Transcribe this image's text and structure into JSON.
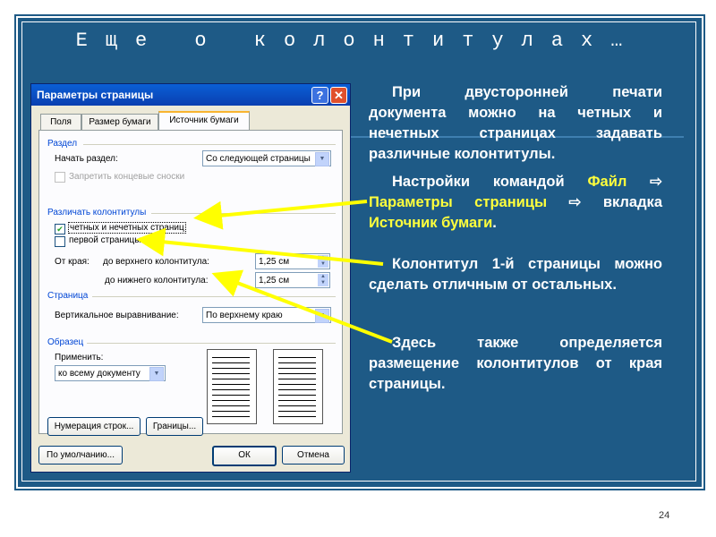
{
  "slide": {
    "title": "Еще о колонтитулах…",
    "page_number": "24",
    "paragraphs": [
      {
        "text": "При двусторонней печати документа можно на четных и нечетных страницах задавать различные колонтитулы."
      },
      {
        "pre": "Настройки командой ",
        "hl1": "Файл",
        "mid1": " ⇨ ",
        "hl2": "Параметры страницы",
        "mid2": " ⇨ вкладка ",
        "hl3": "Источник бумаги",
        "post": "."
      },
      {
        "text": "Колонтитул 1-й страницы можно сделать отличным от остальных."
      },
      {
        "text": "Здесь также определяется размещение колонтитулов от края страницы."
      }
    ],
    "colors": {
      "background": "#1e5a86",
      "highlight": "#ffff3c",
      "arrow": "#ffff00"
    }
  },
  "dialog": {
    "title": "Параметры страницы",
    "help_icon": "?",
    "close_icon": "✕",
    "tabs": [
      {
        "label": "Поля"
      },
      {
        "label": "Размер бумаги"
      },
      {
        "label": "Источник бумаги"
      }
    ],
    "section_razdel": "Раздел",
    "start_label": "Начать раздел:",
    "start_value": "Со следующей страницы",
    "suppress_endnotes": "Запретить концевые сноски",
    "section_headers": "Различать колонтитулы",
    "odd_even_label": "четных и нечетных страниц",
    "odd_even_checked": true,
    "first_page_label": "первой страницы",
    "first_page_checked": false,
    "from_edge_label": "От края:",
    "header_dist_label": "до верхнего колонтитула:",
    "header_dist_value": "1,25 см",
    "footer_dist_label": "до нижнего колонтитула:",
    "footer_dist_value": "1,25 см",
    "section_page": "Страница",
    "valign_label": "Вертикальное выравнивание:",
    "valign_value": "По верхнему краю",
    "section_sample": "Образец",
    "apply_label": "Применить:",
    "apply_value": "ко всему документу",
    "line_numbers_button": "Нумерация строк...",
    "borders_button": "Границы...",
    "default_button": "По умолчанию...",
    "ok_button": "ОК",
    "cancel_button": "Отмена"
  }
}
